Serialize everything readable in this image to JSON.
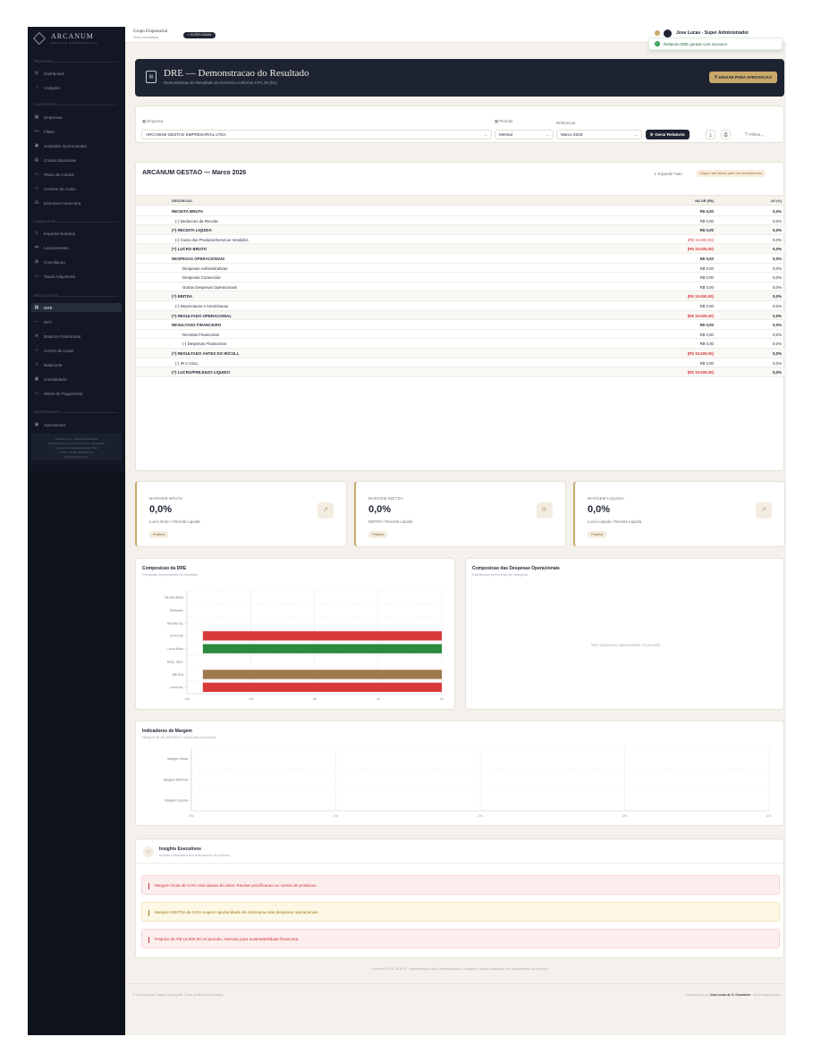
{
  "brand": {
    "name": "ARCANUM",
    "tagline": "GESTAO EMPRESARIAL"
  },
  "sidebar": {
    "sections": [
      {
        "label": "PRINCIPAL",
        "top": 37
      },
      {
        "label": "CADASTROS",
        "top": 85
      },
      {
        "label": "FINANCEIRO",
        "top": 216
      },
      {
        "label": "RELATORIOS",
        "top": 299
      },
      {
        "label": "GOVERNANCA",
        "top": 429
      }
    ],
    "items": [
      {
        "label": "Dashboard",
        "icon": "⊞",
        "name": "dashboard",
        "top": 47
      },
      {
        "label": "Analytics",
        "icon": "◔",
        "name": "analytics",
        "top": 63
      },
      {
        "label": "Empresas",
        "icon": "▦",
        "name": "empresas",
        "top": 96
      },
      {
        "label": "Filiais",
        "icon": "⊷",
        "name": "filiais",
        "top": 112
      },
      {
        "label": "Unidades Operacionais",
        "icon": "▣",
        "name": "unidades-operacionais",
        "top": 128
      },
      {
        "label": "Contas Bancarias",
        "icon": "▤",
        "name": "contas-bancarias",
        "top": 144
      },
      {
        "label": "Plano de Contas",
        "icon": "▭",
        "name": "plano-de-contas",
        "top": 160
      },
      {
        "label": "Centros de Custo",
        "icon": "⊹",
        "name": "centros-de-custo",
        "top": 176
      },
      {
        "label": "Estrutura Financeira",
        "icon": "⁂",
        "name": "estrutura-financeira",
        "top": 192
      },
      {
        "label": "Importar Extratos",
        "icon": "⇪",
        "name": "importar-extratos",
        "top": 226
      },
      {
        "label": "Lancamentos",
        "icon": "⇄",
        "name": "lancamentos",
        "top": 242
      },
      {
        "label": "Conciliacao",
        "icon": "⊠",
        "name": "conciliacao",
        "top": 258
      },
      {
        "label": "Taxas Adquirente",
        "icon": "▭",
        "name": "taxas-adquirente",
        "top": 274
      },
      {
        "label": "DRE",
        "icon": "▤",
        "name": "dre",
        "top": 309,
        "active": true
      },
      {
        "label": "DFC",
        "icon": "∼",
        "name": "dfc",
        "top": 325
      },
      {
        "label": "Balanco Patrimonial",
        "icon": "⊜",
        "name": "balanco-patrimonial",
        "top": 341
      },
      {
        "label": "Centro de Custo",
        "icon": "⊹",
        "name": "centro-de-custo",
        "top": 357
      },
      {
        "label": "Balancete",
        "icon": "⁞⁞",
        "name": "balancete",
        "top": 373
      },
      {
        "label": "Consolidado",
        "icon": "▣",
        "name": "consolidado",
        "top": 389
      },
      {
        "label": "Meios de Pagamento",
        "icon": "▭",
        "name": "meios-de-pagamento",
        "top": 405
      },
      {
        "label": "Aprovacoes",
        "icon": "▣",
        "name": "aprovacoes",
        "top": 440
      }
    ],
    "footer": [
      "Arcanum v1.0 - Gestao Empresarial",
      "Desenvolvido por Jose Lucas de S. Goncalves",
      "Arcanum Gestao Empresarial LTDA",
      "CNPJ: 64.402.183/0001-32",
      "arcanumgestao.com"
    ]
  },
  "topbar": {
    "org": "Grupo Empresarial",
    "org_sub": "Visao consolidada",
    "badge": "☉ SUPER ADMIN",
    "user": "Jose Lucas - Super Administrador"
  },
  "toast": {
    "message": "Relatorio DRE gerado com sucesso!"
  },
  "header": {
    "title": "DRE — Demonstracao do Resultado",
    "subtitle": "Demonstracao do Resultado do Exercicio conforme CPC 26 (R1)",
    "submit_label": "⇱ ENVIAR PARA APROVACAO"
  },
  "filters": {
    "empresa_label": "▦ Empresa",
    "empresa_value": "ARCANUM GESTAO EMPRESARIAL LTDA",
    "periodo_label": "▦ Periodo",
    "periodo_value": "Mensal",
    "referencia_label": "Referencia",
    "referencia_value": "Marco 2026",
    "generate_label": "⊪ Gerar Relatorio",
    "export_icon": "⤓",
    "print_icon": "⎙",
    "filters_label": "⛉ Filtros ⌄"
  },
  "dre": {
    "title": "ARCANUM GESTAO — Marco 2026",
    "expand_label": "⇕ Expandir Tudo",
    "hint": "Clique nas linhas para ver lancamentos",
    "columns": {
      "desc": "DESCRICAO",
      "valor": "VALOR (R$)",
      "av": "AV (%)"
    },
    "rows": [
      {
        "desc": "RECEITA BRUTA",
        "valor": "R$ 0,00",
        "av": "0,0%",
        "bold": true,
        "indent": 0
      },
      {
        "desc": "(-) Deducoes da Receita",
        "valor": "R$ 0,00",
        "av": "0,0%",
        "bold": false,
        "indent": 1
      },
      {
        "desc": "(=) RECEITA LIQUIDA",
        "valor": "R$ 0,00",
        "av": "0,0%",
        "bold": true,
        "indent": 0,
        "hl": true
      },
      {
        "desc": "(-) Custo dos Produtos/Servicos Vendidos",
        "valor": "(R$ 15.000,00)",
        "av": "0,0%",
        "bold": false,
        "indent": 1,
        "neg": true,
        "expand": true
      },
      {
        "desc": "(=) LUCRO BRUTO",
        "valor": "(R$ 15.000,00)",
        "av": "0,0%",
        "bold": true,
        "indent": 0,
        "neg": true,
        "hl": true
      },
      {
        "desc": "DESPESAS OPERACIONAIS",
        "valor": "R$ 0,00",
        "av": "0,0%",
        "bold": true,
        "indent": 0
      },
      {
        "desc": "Despesas Administrativas",
        "valor": "R$ 0,00",
        "av": "0,0%",
        "bold": false,
        "indent": 2
      },
      {
        "desc": "Despesas Comerciais",
        "valor": "R$ 0,00",
        "av": "0,0%",
        "bold": false,
        "indent": 2
      },
      {
        "desc": "Outras Despesas Operacionais",
        "valor": "R$ 0,00",
        "av": "0,0%",
        "bold": false,
        "indent": 2
      },
      {
        "desc": "(=) EBITDA",
        "valor": "(R$ 15.000,00)",
        "av": "0,0%",
        "bold": true,
        "indent": 0,
        "neg": true,
        "hl": true
      },
      {
        "desc": "(-) Depreciacao e Amortizacao",
        "valor": "R$ 0,00",
        "av": "0,0%",
        "bold": false,
        "indent": 1
      },
      {
        "desc": "(=) RESULTADO OPERACIONAL",
        "valor": "(R$ 15.000,00)",
        "av": "0,0%",
        "bold": true,
        "indent": 0,
        "neg": true,
        "hl": true
      },
      {
        "desc": "RESULTADO FINANCEIRO",
        "valor": "R$ 0,00",
        "av": "0,0%",
        "bold": true,
        "indent": 0
      },
      {
        "desc": "Receitas Financeiras",
        "valor": "R$ 0,00",
        "av": "0,0%",
        "bold": false,
        "indent": 2
      },
      {
        "desc": "(-) Despesas Financeiras",
        "valor": "R$ 0,00",
        "av": "0,0%",
        "bold": false,
        "indent": 2
      },
      {
        "desc": "(=) RESULTADO ANTES DO IR/CSLL",
        "valor": "(R$ 15.000,00)",
        "av": "0,0%",
        "bold": true,
        "indent": 0,
        "neg": true,
        "hl": true
      },
      {
        "desc": "(-) IR e CSLL",
        "valor": "R$ 0,00",
        "av": "0,0%",
        "bold": false,
        "indent": 1
      },
      {
        "desc": "(=) LUCRO/PREJUIZO LIQUIDO",
        "valor": "(R$ 15.000,00)",
        "av": "0,0%",
        "bold": true,
        "indent": 0,
        "neg": true,
        "hl": true
      }
    ]
  },
  "kpis": [
    {
      "title": "MARGEM BRUTA",
      "value": "0,0%",
      "subtitle": "Lucro Bruto / Receita Liquida",
      "badge": "Positiva",
      "icon": "↗"
    },
    {
      "title": "MARGEM EBITDA",
      "value": "0,0%",
      "subtitle": "EBITDA / Receita Liquida",
      "badge": "Positiva",
      "icon": "⊪"
    },
    {
      "title": "MARGEM LIQUIDA",
      "value": "0,0%",
      "subtitle": "Lucro Liquido / Receita Liquida",
      "badge": "Positiva",
      "icon": "↗"
    }
  ],
  "chart_dre": {
    "title": "Composicao da DRE",
    "subtitle": "Principais componentes do resultado"
  },
  "chart_desp": {
    "title": "Composicao das Despesas Operacionais",
    "subtitle": "Distribuicao percentual por categoria",
    "empty": "Sem despesas operacionais no periodo"
  },
  "chart_ind": {
    "title": "Indicadores de Margem",
    "subtitle": "Margens Bruta, EBITDA e Liquida em percentual"
  },
  "chart_data": [
    {
      "type": "bar",
      "orientation": "horizontal",
      "categories": [
        "Receita Bruta",
        "Deducoes",
        "Receita Liq.",
        "CPV/CSP",
        "Lucro Bruto",
        "Desp. Oper.",
        "EBITDA",
        "Lucro Liq."
      ],
      "values": [
        0,
        0,
        0,
        -15000,
        -15000,
        0,
        -15000,
        -15000
      ],
      "colors": [
        "#d83a3a",
        "#d83a3a",
        "#d83a3a",
        "#d83a3a",
        "#2c8a3e",
        "#d83a3a",
        "#a0784e",
        "#d83a3a"
      ],
      "xlim": [
        -16000,
        0
      ],
      "xticks": [
        -16000,
        -12000,
        -8000,
        -4000,
        0
      ],
      "xtick_labels": [
        "-16k",
        "-12k",
        "-8k",
        "-4k",
        "0k"
      ],
      "grid": true
    },
    {
      "type": "bar",
      "orientation": "horizontal",
      "categories": [
        "Margem Bruta",
        "Margem EBITDA",
        "Margem Liquida"
      ],
      "values": [
        0,
        0,
        0
      ],
      "xlim": [
        0,
        4
      ],
      "xticks": [
        0,
        1,
        2,
        3,
        4
      ],
      "xtick_labels": [
        "0%",
        "1%",
        "2%",
        "3%",
        "4%"
      ],
      "grid": true
    }
  ],
  "insights": {
    "title": "Insights Executivos",
    "subtitle": "Analise automatica dos indicadores do periodo",
    "items": [
      {
        "text": "Margem bruta de 0,0% esta abaixo do ideal. Revisar precificacao ou custos de producao.",
        "level": "red"
      },
      {
        "text": "Margem EBITDA de 0,0% sugere oportunidade de otimizacao das despesas operacionais.",
        "level": "yel"
      },
      {
        "text": "Prejuizo de R$ 15.000,00 no periodo. Atencao para sustentabilidade financeira.",
        "level": "red"
      }
    ]
  },
  "footer": {
    "note": "Conforme CPC 26 (R1) - Apresentacao das Demonstracoes Contabeis. Dados baseados em lancamentos do periodo.",
    "copyright": "© 2026 Arcanum Gestao Empresarial. Todos os direitos reservados.",
    "dev_prefix": "Desenvolvido por ",
    "dev_name": "Jose Lucas de S. Goncalves",
    "dev_suffix": " · arcanumgestao.com"
  }
}
